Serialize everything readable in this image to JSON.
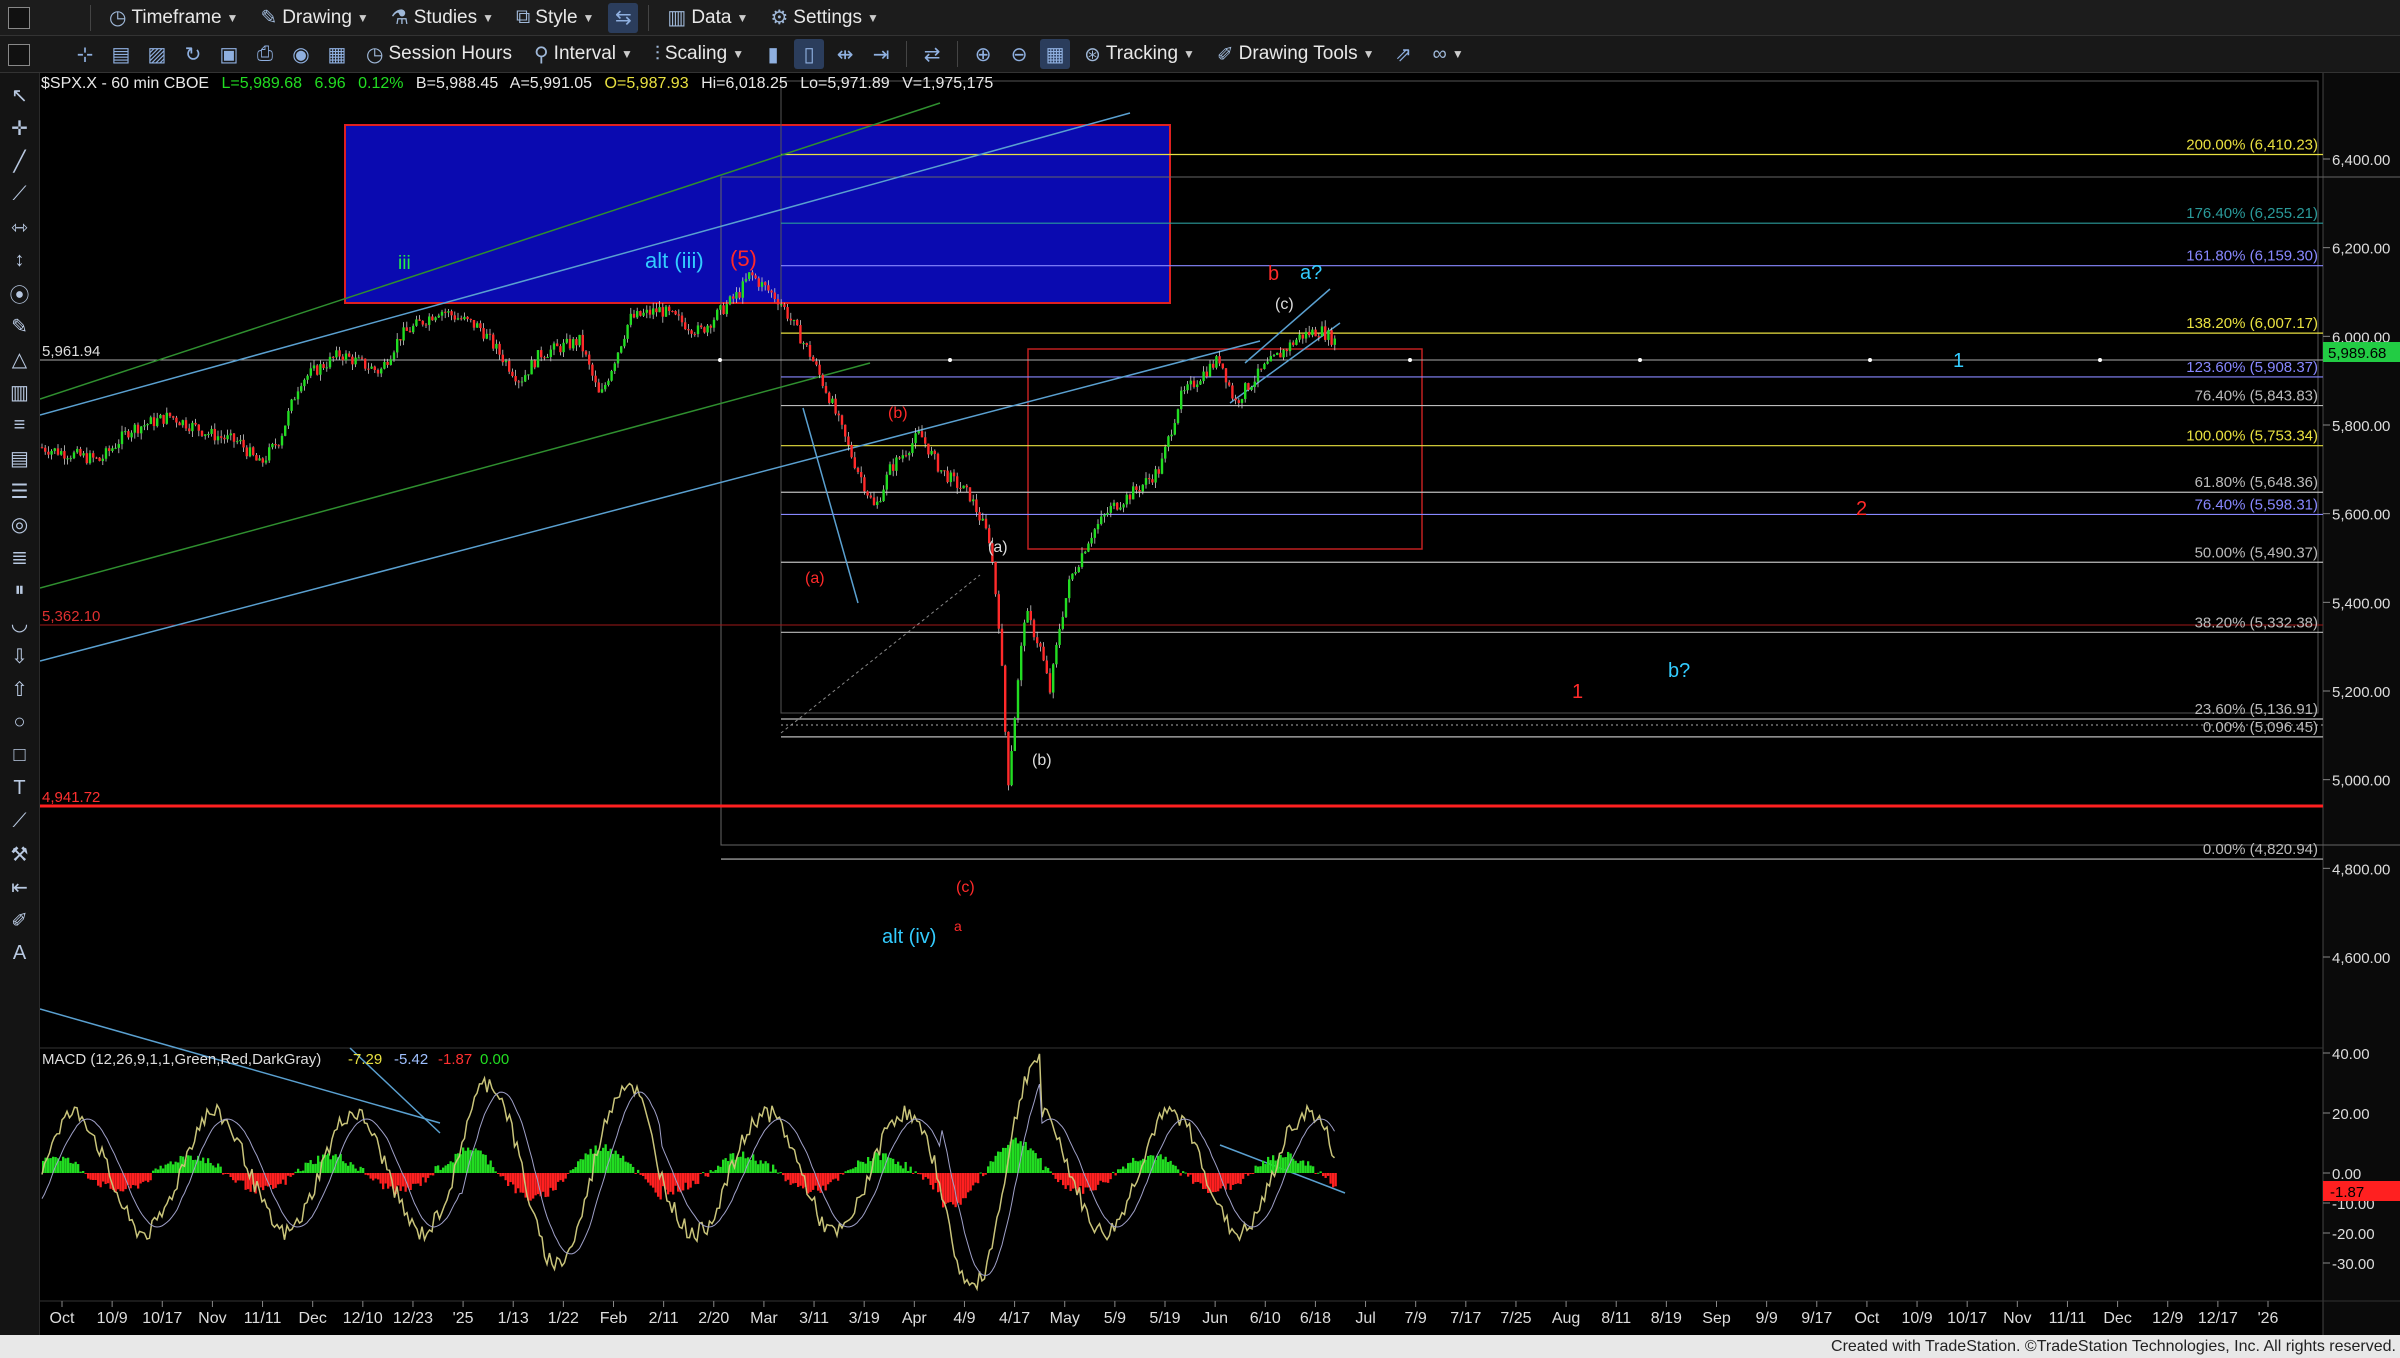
{
  "toolbar1": {
    "timeframe": "Timeframe",
    "drawing": "Drawing",
    "studies": "Studies",
    "style": "Style",
    "data": "Data",
    "settings": "Settings"
  },
  "toolbar2": {
    "session_hours": "Session Hours",
    "interval": "Interval",
    "scaling": "Scaling",
    "tracking": "Tracking",
    "drawing_tools": "Drawing Tools"
  },
  "header": {
    "symbol": "$SPX.X - 60 min  CBOE",
    "last": "L=5,989.68",
    "change": "6.96",
    "change_pct": "0.12%",
    "bid": "B=5,988.45",
    "ask": "A=5,991.05",
    "open": "O=5,987.93",
    "high": "Hi=6,018.25",
    "low": "Lo=5,971.89",
    "volume": "V=1,975,175"
  },
  "colors": {
    "up": "#22dd22",
    "down": "#ff2a2a",
    "cyan": "#33ccff",
    "red_label": "#ff2222",
    "blue_box": "#0a0ab0",
    "yellow": "#e8e040"
  },
  "price_axis": [
    "6,400.00",
    "6,200.00",
    "6,000.00",
    "5,800.00",
    "5,600.00",
    "5,400.00",
    "5,200.00",
    "5,000.00",
    "4,800.00",
    "4,600.00"
  ],
  "price_badge": "5,989.68",
  "macd_axis": [
    "40.00",
    "20.00",
    "0.00",
    "-10.00",
    "-20.00",
    "-30.00"
  ],
  "macd_badge": "-1.87",
  "time_axis": [
    "Oct",
    "10/9",
    "10/17",
    "Nov",
    "11/11",
    "Dec",
    "12/10",
    "12/23",
    "'25",
    "1/13",
    "1/22",
    "Feb",
    "2/11",
    "2/20",
    "Mar",
    "3/11",
    "3/19",
    "Apr",
    "4/9",
    "4/17",
    "May",
    "5/9",
    "5/19",
    "Jun",
    "6/10",
    "6/18",
    "Jul",
    "7/9",
    "7/17",
    "7/25",
    "Aug",
    "8/11",
    "8/19",
    "Sep",
    "9/9",
    "9/17",
    "Oct",
    "10/9",
    "10/17",
    "Nov",
    "11/11",
    "Dec",
    "12/9",
    "12/17",
    "'26"
  ],
  "fib_levels": [
    {
      "label": "200.00% (6,410.23)",
      "color": "#e8e040"
    },
    {
      "label": "176.40% (6,255.21)",
      "color": "#2a9a9a"
    },
    {
      "label": "161.80% (6,159.30)",
      "color": "#8888ff"
    },
    {
      "label": "138.20% (6,007.17)",
      "color": "#e8e040"
    },
    {
      "label": "123.60% (5,908.37)",
      "color": "#8888ff"
    },
    {
      "label": "76.40% (5,843.83)",
      "color": "#bbbbbb"
    },
    {
      "label": "100.00% (5,753.34)",
      "color": "#e8e040"
    },
    {
      "label": "61.80% (5,648.36)",
      "color": "#bbbbbb"
    },
    {
      "label": "76.40% (5,598.31)",
      "color": "#8888ff"
    },
    {
      "label": "50.00% (5,490.37)",
      "color": "#bbbbbb"
    },
    {
      "label": "38.20% (5,332.38)",
      "color": "#bbbbbb"
    },
    {
      "label": "23.60% (5,136.91)",
      "color": "#bbbbbb"
    },
    {
      "label": "0.00% (5,096.45)",
      "color": "#bbbbbb"
    },
    {
      "label": "0.00% (4,820.94)",
      "color": "#bbbbbb"
    }
  ],
  "left_levels": [
    "5,961.94",
    "5,362.10",
    "4,941.72"
  ],
  "wave_labels": {
    "iii": "iii",
    "alt_iii": "alt (iii)",
    "five": "(5)",
    "b_red": "b",
    "a_q": "a?",
    "c_top": "(c)",
    "b_small": "(b)",
    "a_small_red": "(a)",
    "a_white": "(a)",
    "b_white": "(b)",
    "c_red": "(c)",
    "a_red": "a",
    "alt_iv": "alt (iv)",
    "one_cyan": "1",
    "two_red": "2",
    "one_red": "1",
    "b_q": "b?"
  },
  "macd": {
    "title": "MACD (12,26,9,1,1,Green,Red,DarkGray)",
    "v1": "-7.29",
    "v2": "-5.42",
    "v3": "-1.87",
    "v4": "0.00"
  },
  "footer": "Created with TradeStation. ©TradeStation Technologies, Inc. All rights reserved."
}
